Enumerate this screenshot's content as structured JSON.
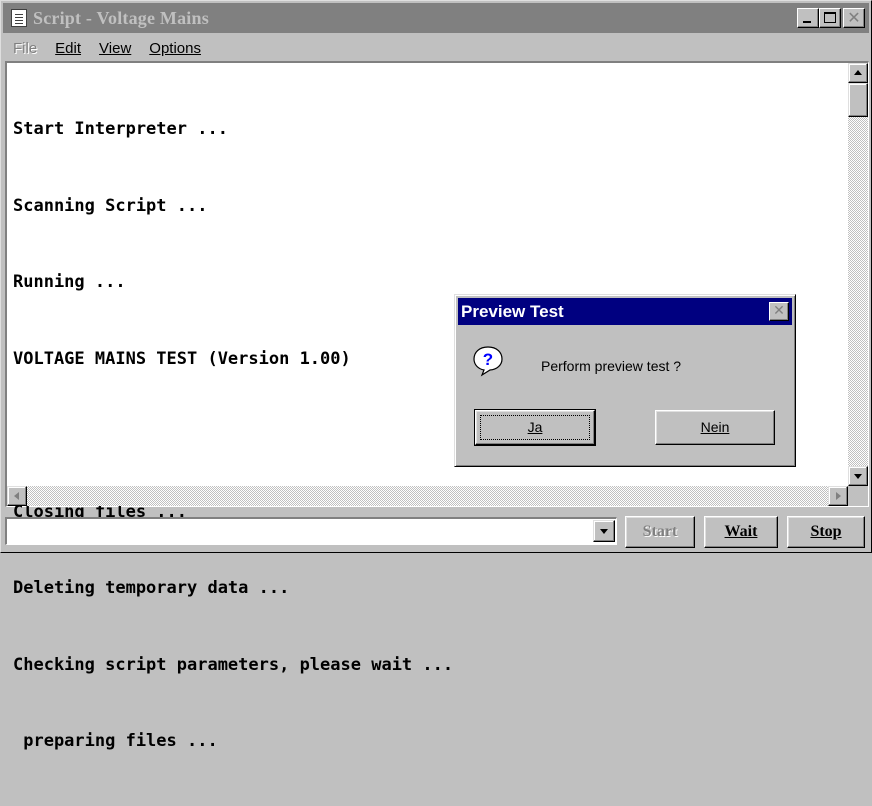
{
  "window": {
    "title": "Script - Voltage Mains",
    "icon": "document-icon"
  },
  "menu": {
    "file": "File",
    "edit": "Edit",
    "view": "View",
    "options": "Options"
  },
  "console": {
    "lines": [
      "Start Interpreter ...",
      "Scanning Script ...",
      "Running ...",
      "VOLTAGE MAINS TEST (Version 1.00)",
      "",
      "Closing files ...",
      "Deleting temporary data ...",
      "Checking script parameters, please wait ...",
      " preparing files ..."
    ]
  },
  "dialog": {
    "title": "Preview Test",
    "message": "Perform preview test ?",
    "yes_label": "Ja",
    "no_label": "Nein",
    "icon": "question-icon"
  },
  "bottom": {
    "combo_value": "",
    "start_label": "Start",
    "wait_label": "Wait",
    "stop_label": "Stop"
  },
  "colors": {
    "dialog_title_bg": "#000080",
    "inactive_title_bg": "#808080",
    "face": "#c0c0c0"
  }
}
